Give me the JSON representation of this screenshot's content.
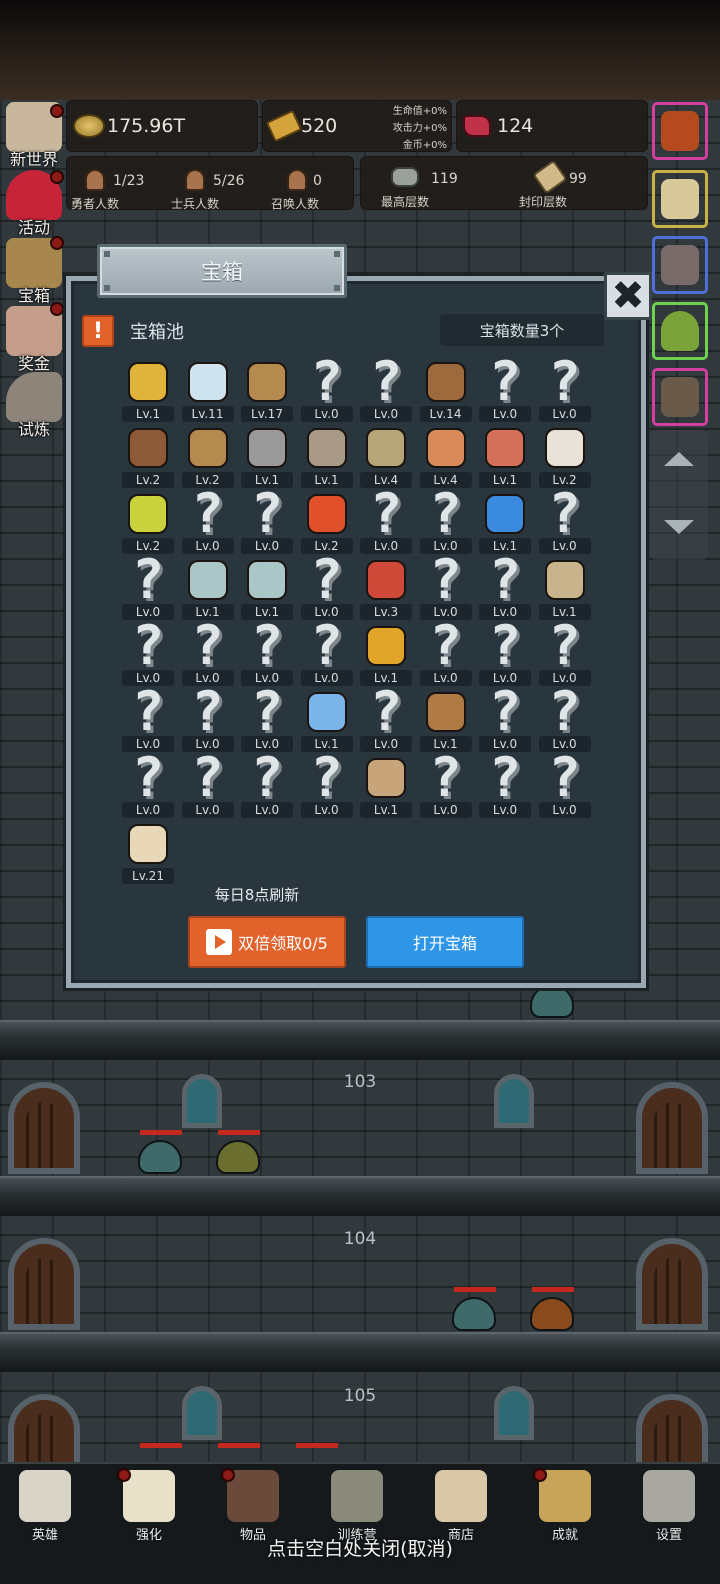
{
  "hud": {
    "gold": "175.96T",
    "bars": "520",
    "ruby": "124",
    "bonus_hp": "生命值+0%",
    "bonus_atk": "攻击力+0%",
    "bonus_gold": "金币+0%",
    "heroes_count": "1/23",
    "heroes_label": "勇者人数",
    "soldiers_count": "5/26",
    "soldiers_label": "士兵人数",
    "summons_count": "0",
    "summons_label": "召唤人数",
    "max_floor": "119",
    "max_floor_label": "最高层数",
    "sealed_floor": "99",
    "sealed_floor_label": "封印层数"
  },
  "side": {
    "new_world": "新世界",
    "events": "活动",
    "chest": "宝箱",
    "reward": "奖金",
    "trial": "试炼"
  },
  "floors": [
    "103",
    "104",
    "105"
  ],
  "modal": {
    "title": "宝箱",
    "close_icon": "✖",
    "pool_title": "宝箱池",
    "alert_symbol": "!",
    "chest_count": "宝箱数量3个",
    "refresh_note": "每日8点刷新",
    "ad_button": "双倍领取0/5",
    "open_button": "打开宝箱"
  },
  "items": [
    {
      "icon": "crown-icon",
      "level": "Lv.1"
    },
    {
      "icon": "diamond-icon",
      "level": "Lv.11"
    },
    {
      "icon": "wooden-sword-icon",
      "level": "Lv.17"
    },
    {
      "icon": "unknown-icon",
      "level": "Lv.0"
    },
    {
      "icon": "unknown-icon",
      "level": "Lv.0"
    },
    {
      "icon": "leather-armor-icon",
      "level": "Lv.14"
    },
    {
      "icon": "unknown-icon",
      "level": "Lv.0"
    },
    {
      "icon": "unknown-icon",
      "level": "Lv.0"
    },
    {
      "icon": "leather-cap-icon",
      "level": "Lv.2"
    },
    {
      "icon": "dagger-icon",
      "level": "Lv.2"
    },
    {
      "icon": "iron-helmet-icon",
      "level": "Lv.1"
    },
    {
      "icon": "hammer-icon",
      "level": "Lv.1"
    },
    {
      "icon": "knight-helmet-icon",
      "level": "Lv.4"
    },
    {
      "icon": "ham-icon",
      "level": "Lv.4"
    },
    {
      "icon": "steak-icon",
      "level": "Lv.1"
    },
    {
      "icon": "rice-bowl-icon",
      "level": "Lv.2"
    },
    {
      "icon": "yellow-potion-icon",
      "level": "Lv.2"
    },
    {
      "icon": "unknown-icon",
      "level": "Lv.0"
    },
    {
      "icon": "unknown-icon",
      "level": "Lv.0"
    },
    {
      "icon": "red-potion-icon",
      "level": "Lv.2"
    },
    {
      "icon": "unknown-icon",
      "level": "Lv.0"
    },
    {
      "icon": "unknown-icon",
      "level": "Lv.0"
    },
    {
      "icon": "blue-potion-icon",
      "level": "Lv.1"
    },
    {
      "icon": "unknown-icon",
      "level": "Lv.0"
    },
    {
      "icon": "unknown-icon",
      "level": "Lv.0"
    },
    {
      "icon": "empty-bottle-icon",
      "level": "Lv.1"
    },
    {
      "icon": "empty-bottle-icon",
      "level": "Lv.1"
    },
    {
      "icon": "unknown-icon",
      "level": "Lv.0"
    },
    {
      "icon": "red-vial-icon",
      "level": "Lv.3"
    },
    {
      "icon": "unknown-icon",
      "level": "Lv.0"
    },
    {
      "icon": "unknown-icon",
      "level": "Lv.0"
    },
    {
      "icon": "boot-icon",
      "level": "Lv.1"
    },
    {
      "icon": "unknown-icon",
      "level": "Lv.0"
    },
    {
      "icon": "unknown-icon",
      "level": "Lv.0"
    },
    {
      "icon": "unknown-icon",
      "level": "Lv.0"
    },
    {
      "icon": "unknown-icon",
      "level": "Lv.0"
    },
    {
      "icon": "torch-icon",
      "level": "Lv.1"
    },
    {
      "icon": "unknown-icon",
      "level": "Lv.0"
    },
    {
      "icon": "unknown-icon",
      "level": "Lv.0"
    },
    {
      "icon": "unknown-icon",
      "level": "Lv.0"
    },
    {
      "icon": "unknown-icon",
      "level": "Lv.0"
    },
    {
      "icon": "unknown-icon",
      "level": "Lv.0"
    },
    {
      "icon": "unknown-icon",
      "level": "Lv.0"
    },
    {
      "icon": "magic-staff-icon",
      "level": "Lv.1"
    },
    {
      "icon": "unknown-icon",
      "level": "Lv.0"
    },
    {
      "icon": "backpack-icon",
      "level": "Lv.1"
    },
    {
      "icon": "unknown-icon",
      "level": "Lv.0"
    },
    {
      "icon": "unknown-icon",
      "level": "Lv.0"
    },
    {
      "icon": "unknown-icon",
      "level": "Lv.0"
    },
    {
      "icon": "unknown-icon",
      "level": "Lv.0"
    },
    {
      "icon": "unknown-icon",
      "level": "Lv.0"
    },
    {
      "icon": "unknown-icon",
      "level": "Lv.0"
    },
    {
      "icon": "bow-icon",
      "level": "Lv.1"
    },
    {
      "icon": "unknown-icon",
      "level": "Lv.0"
    },
    {
      "icon": "unknown-icon",
      "level": "Lv.0"
    },
    {
      "icon": "unknown-icon",
      "level": "Lv.0"
    },
    {
      "icon": "beer-mug-icon",
      "level": "Lv.21"
    }
  ],
  "nav": [
    {
      "label": "英雄",
      "icon": "skull-icon"
    },
    {
      "label": "强化",
      "icon": "candle-icon"
    },
    {
      "label": "物品",
      "icon": "book-icon"
    },
    {
      "label": "训练营",
      "icon": "lantern-icon"
    },
    {
      "label": "商店",
      "icon": "beer-mug-icon"
    },
    {
      "label": "成就",
      "icon": "key-icon"
    },
    {
      "label": "设置",
      "icon": "gear-icon"
    }
  ],
  "close_hint": "点击空白处关闭(取消)",
  "colors": {
    "orange_button": "#e2622b",
    "blue_button": "#2f95e6",
    "modal_bg": "#2a363e"
  }
}
